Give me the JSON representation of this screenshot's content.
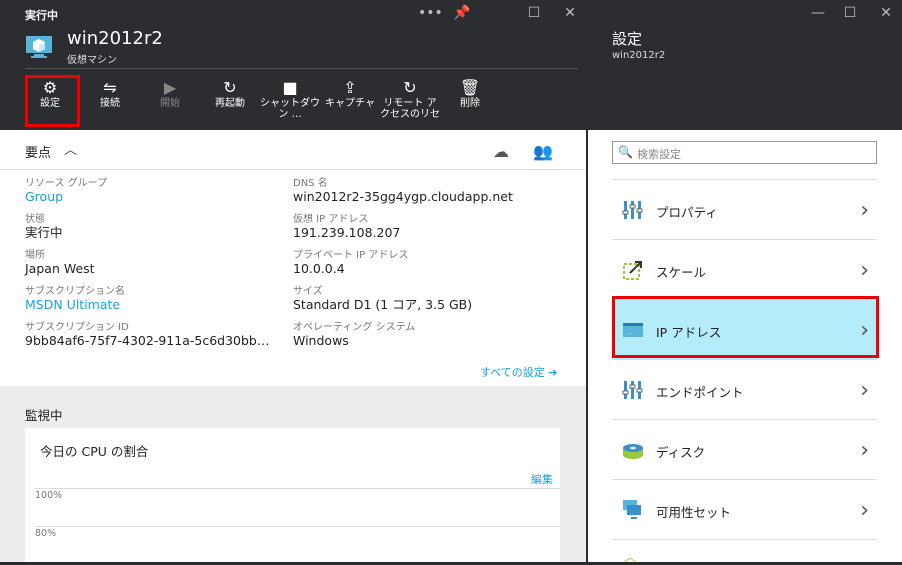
{
  "left_blade": {
    "status": "実行中",
    "vm_name": "win2012r2",
    "vm_type": "仮想マシン",
    "toolbar": [
      {
        "label": "設定",
        "icon": "gear-icon"
      },
      {
        "label": "接続",
        "icon": "connect-icon"
      },
      {
        "label": "開始",
        "icon": "play-icon",
        "disabled": true
      },
      {
        "label": "再起動",
        "icon": "restart-icon"
      },
      {
        "label": "シャットダウ ン …",
        "icon": "stop-icon"
      },
      {
        "label": "キャプチャ",
        "icon": "capture-icon"
      },
      {
        "label": "リモート ア クセスのリセ",
        "icon": "reset-icon"
      },
      {
        "label": "削除",
        "icon": "trash-icon"
      }
    ],
    "essentials": {
      "title": "要点",
      "left": [
        {
          "key": "リソース グループ",
          "value": "Group",
          "link": true
        },
        {
          "key": "状態",
          "value": "実行中"
        },
        {
          "key": "場所",
          "value": "Japan West"
        },
        {
          "key": "サブスクリプション名",
          "value": "MSDN Ultimate",
          "link": true
        },
        {
          "key": "サブスクリプション ID",
          "value": "9bb84af6-75f7-4302-911a-5c6d30bb…"
        }
      ],
      "right": [
        {
          "key": "DNS 名",
          "value": "win2012r2-35gg4ygp.cloudapp.net"
        },
        {
          "key": "仮想 IP アドレス",
          "value": "191.239.108.207"
        },
        {
          "key": "プライベート IP アドレス",
          "value": "10.0.0.4"
        },
        {
          "key": "サイズ",
          "value": "Standard D1 (1 コア, 3.5 GB)"
        },
        {
          "key": "オペレーティング システム",
          "value": "Windows"
        }
      ],
      "all_settings": "すべての設定 ➔"
    },
    "monitoring": {
      "title": "監視中",
      "card_title": "今日の CPU の割合",
      "edit": "編集",
      "ticks": [
        "100%",
        "80%"
      ]
    }
  },
  "right_blade": {
    "title": "設定",
    "subtitle": "win2012r2",
    "search_placeholder": "検索設定",
    "items": [
      {
        "label": "プロパティ",
        "icon": "properties-icon"
      },
      {
        "label": "スケール",
        "icon": "scale-icon"
      },
      {
        "label": "IP アドレス",
        "icon": "ip-address-icon",
        "selected": true
      },
      {
        "label": "エンドポイント",
        "icon": "endpoint-icon"
      },
      {
        "label": "ディスク",
        "icon": "disk-icon"
      },
      {
        "label": "可用性セット",
        "icon": "availability-set-icon"
      }
    ]
  },
  "colors": {
    "accent": "#1a9fd8",
    "highlight": "#e00000",
    "selected_bg": "#b4ecfa",
    "dark": "#2c2d30"
  }
}
